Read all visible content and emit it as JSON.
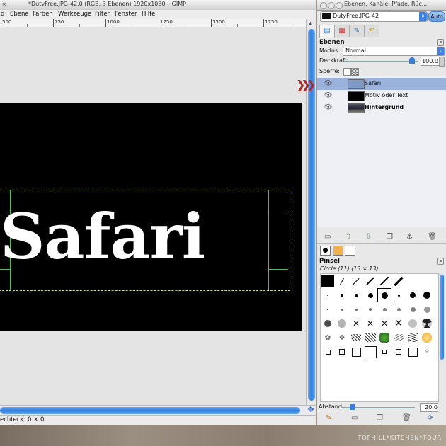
{
  "image_window": {
    "title": "*DutyFree.JPG-42.0 (RGB, 3 Ebenen) 1920x1080 – GIMP",
    "menu": [
      {
        "label": "d",
        "accel": ""
      },
      {
        "label": "Ebene",
        "accel": "E"
      },
      {
        "label": "Farben",
        "accel": "F"
      },
      {
        "label": "Werkzeuge",
        "accel": "W"
      },
      {
        "label": "Filter",
        "accel": "r"
      },
      {
        "label": "Fenster",
        "accel": "F"
      },
      {
        "label": "Hilfe",
        "accel": "H"
      }
    ],
    "ruler_labels": [
      "500",
      "750",
      "1000",
      "1250",
      "1500",
      "1750"
    ],
    "canvas_text": "Safari",
    "status_text": "echteck: 0 × 0"
  },
  "dock": {
    "title": "Ebenen, Kanäle, Pfade, Rüc...",
    "image_selector": "DutyFree.JPG-42",
    "auto_label": "Auto",
    "layers_panel": {
      "title": "Ebenen",
      "mode_label": "Modus:",
      "mode_value": "Normal",
      "opacity_label": "Deckkraft:",
      "opacity_value": "100.0",
      "lock_label": "Sperre:",
      "layers": [
        {
          "name": "Safari",
          "selected": true,
          "bold": false
        },
        {
          "name": "Motiv oder Text",
          "selected": false,
          "bold": false
        },
        {
          "name": "Hintergrund",
          "selected": false,
          "bold": true
        }
      ]
    },
    "brushes_panel": {
      "title": "Pinsel",
      "brush_info": "Circle (11) (13 × 13)",
      "spacing_label": "Abstand:",
      "spacing_value": "20.0"
    }
  },
  "watermark": "TOPHILL*KITCHEN*TOUR",
  "colors": {
    "accent": "#2f7fe0",
    "selected_layer": "#9bb3dc",
    "pointer_arrows": "#b0282a"
  }
}
